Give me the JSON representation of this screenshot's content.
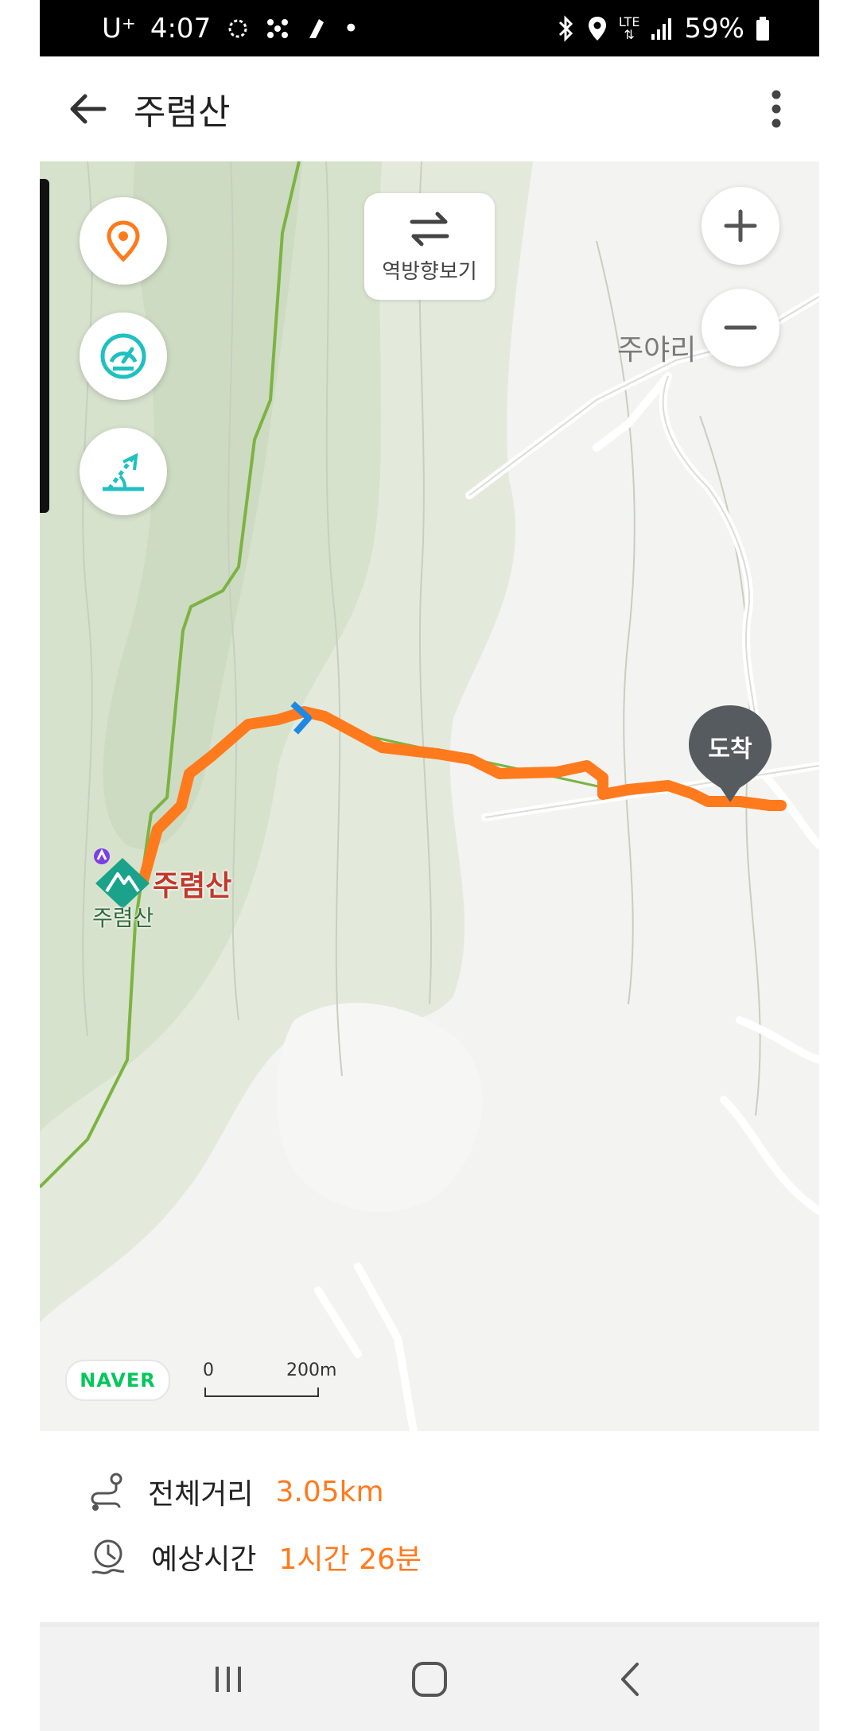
{
  "status_bar": {
    "carrier": "U⁺",
    "time": "4:07",
    "dot": "•",
    "network": "LTE",
    "battery": "59%"
  },
  "app_bar": {
    "title": "주렴산"
  },
  "map": {
    "reverse_button_label": "역방향보기",
    "place_label_village": "주야리",
    "peak_label_main": "주렴산",
    "peak_label_small": "주렴산",
    "arrival_marker_label": "도착",
    "naver_logo_text": "NAVER",
    "scale_zero": "0",
    "scale_distance": "200m",
    "route_color": "#ff7a1c",
    "trail_color": "#7cb342"
  },
  "summary": {
    "distance_label": "전체거리",
    "distance_value": "3.05km",
    "time_label": "예상시간",
    "time_value": "1시간 26분"
  },
  "icons": {
    "back": "arrow-left-icon",
    "more": "more-vert-icon",
    "location": "location-pin-icon",
    "speed": "speedometer-icon",
    "slope": "slope-icon",
    "zoom_in": "plus-icon",
    "zoom_out": "minus-icon",
    "reverse": "swap-arrows-icon"
  }
}
